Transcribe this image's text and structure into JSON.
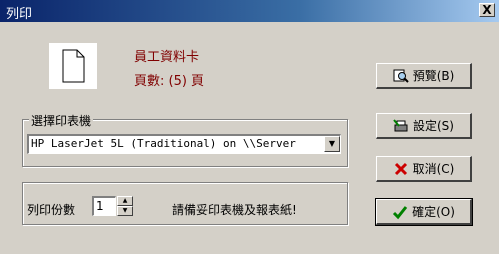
{
  "window": {
    "title": "列印",
    "close_label": "X"
  },
  "document": {
    "name": "員工資料卡",
    "pages_label": "頁數: (5) 頁"
  },
  "printer_group": {
    "legend": "選擇印表機",
    "selected_printer": "HP LaserJet 5L (Traditional) on \\\\Server"
  },
  "copies_group": {
    "label": "列印份數",
    "value": "1",
    "hint": "請備妥印表機及報表紙!"
  },
  "buttons": {
    "preview": "預覽(B)",
    "settings": "設定(S)",
    "cancel": "取消(C)",
    "ok": "確定(O)"
  },
  "icons": {
    "document": "document-icon",
    "preview": "magnifier-icon",
    "settings": "printer-settings-icon",
    "cancel": "cross-icon",
    "ok": "checkmark-icon"
  },
  "colors": {
    "doc_text": "#800000",
    "title_bar": "#0a246a",
    "cancel_red": "#cc0000",
    "ok_green": "#008000"
  }
}
